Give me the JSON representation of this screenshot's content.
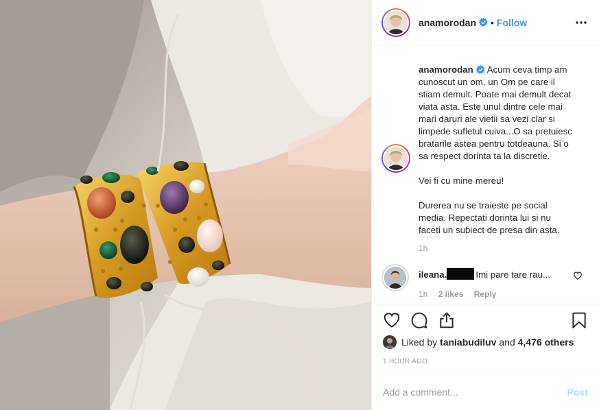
{
  "post": {
    "username": "anamorodan",
    "verified": true,
    "separator": "•",
    "follow_label": "Follow",
    "more_icon": "more-options-icon"
  },
  "caption": {
    "username": "anamorodan",
    "paragraphs": [
      "Acum ceva timp am cunoscut un om, un Om pe care il stiam demult. Poate mai demult decat viata asta. Este unul dintre cele mai mari daruri ale vietii sa vezi clar si limpede sufletul cuiva...O sa pretuiesc bratarile astea pentru totdeauna. Si o sa respect dorinta ta la discretie.",
      "Vei fi cu mine mereu!",
      "Durerea nu se traieste pe social media. Repectati dorinta lui si nu faceti un subiect de presa din asta."
    ],
    "time": "1h"
  },
  "reply": {
    "username": "ileana.",
    "text": "Imi pare tare rau...",
    "time": "1h",
    "likes": "2 likes",
    "reply_label": "Reply"
  },
  "likes": {
    "prefix": "Liked by",
    "user": "taniabudiluv",
    "conjunction": "and",
    "others": "4,476 others"
  },
  "timestamp": "1 HOUR AGO",
  "comment_box": {
    "placeholder": "Add a comment...",
    "post_label": "Post"
  },
  "colors": {
    "accent": "#3897f0",
    "post_disabled": "#b3dbff",
    "muted": "#999999",
    "text": "#262626"
  }
}
